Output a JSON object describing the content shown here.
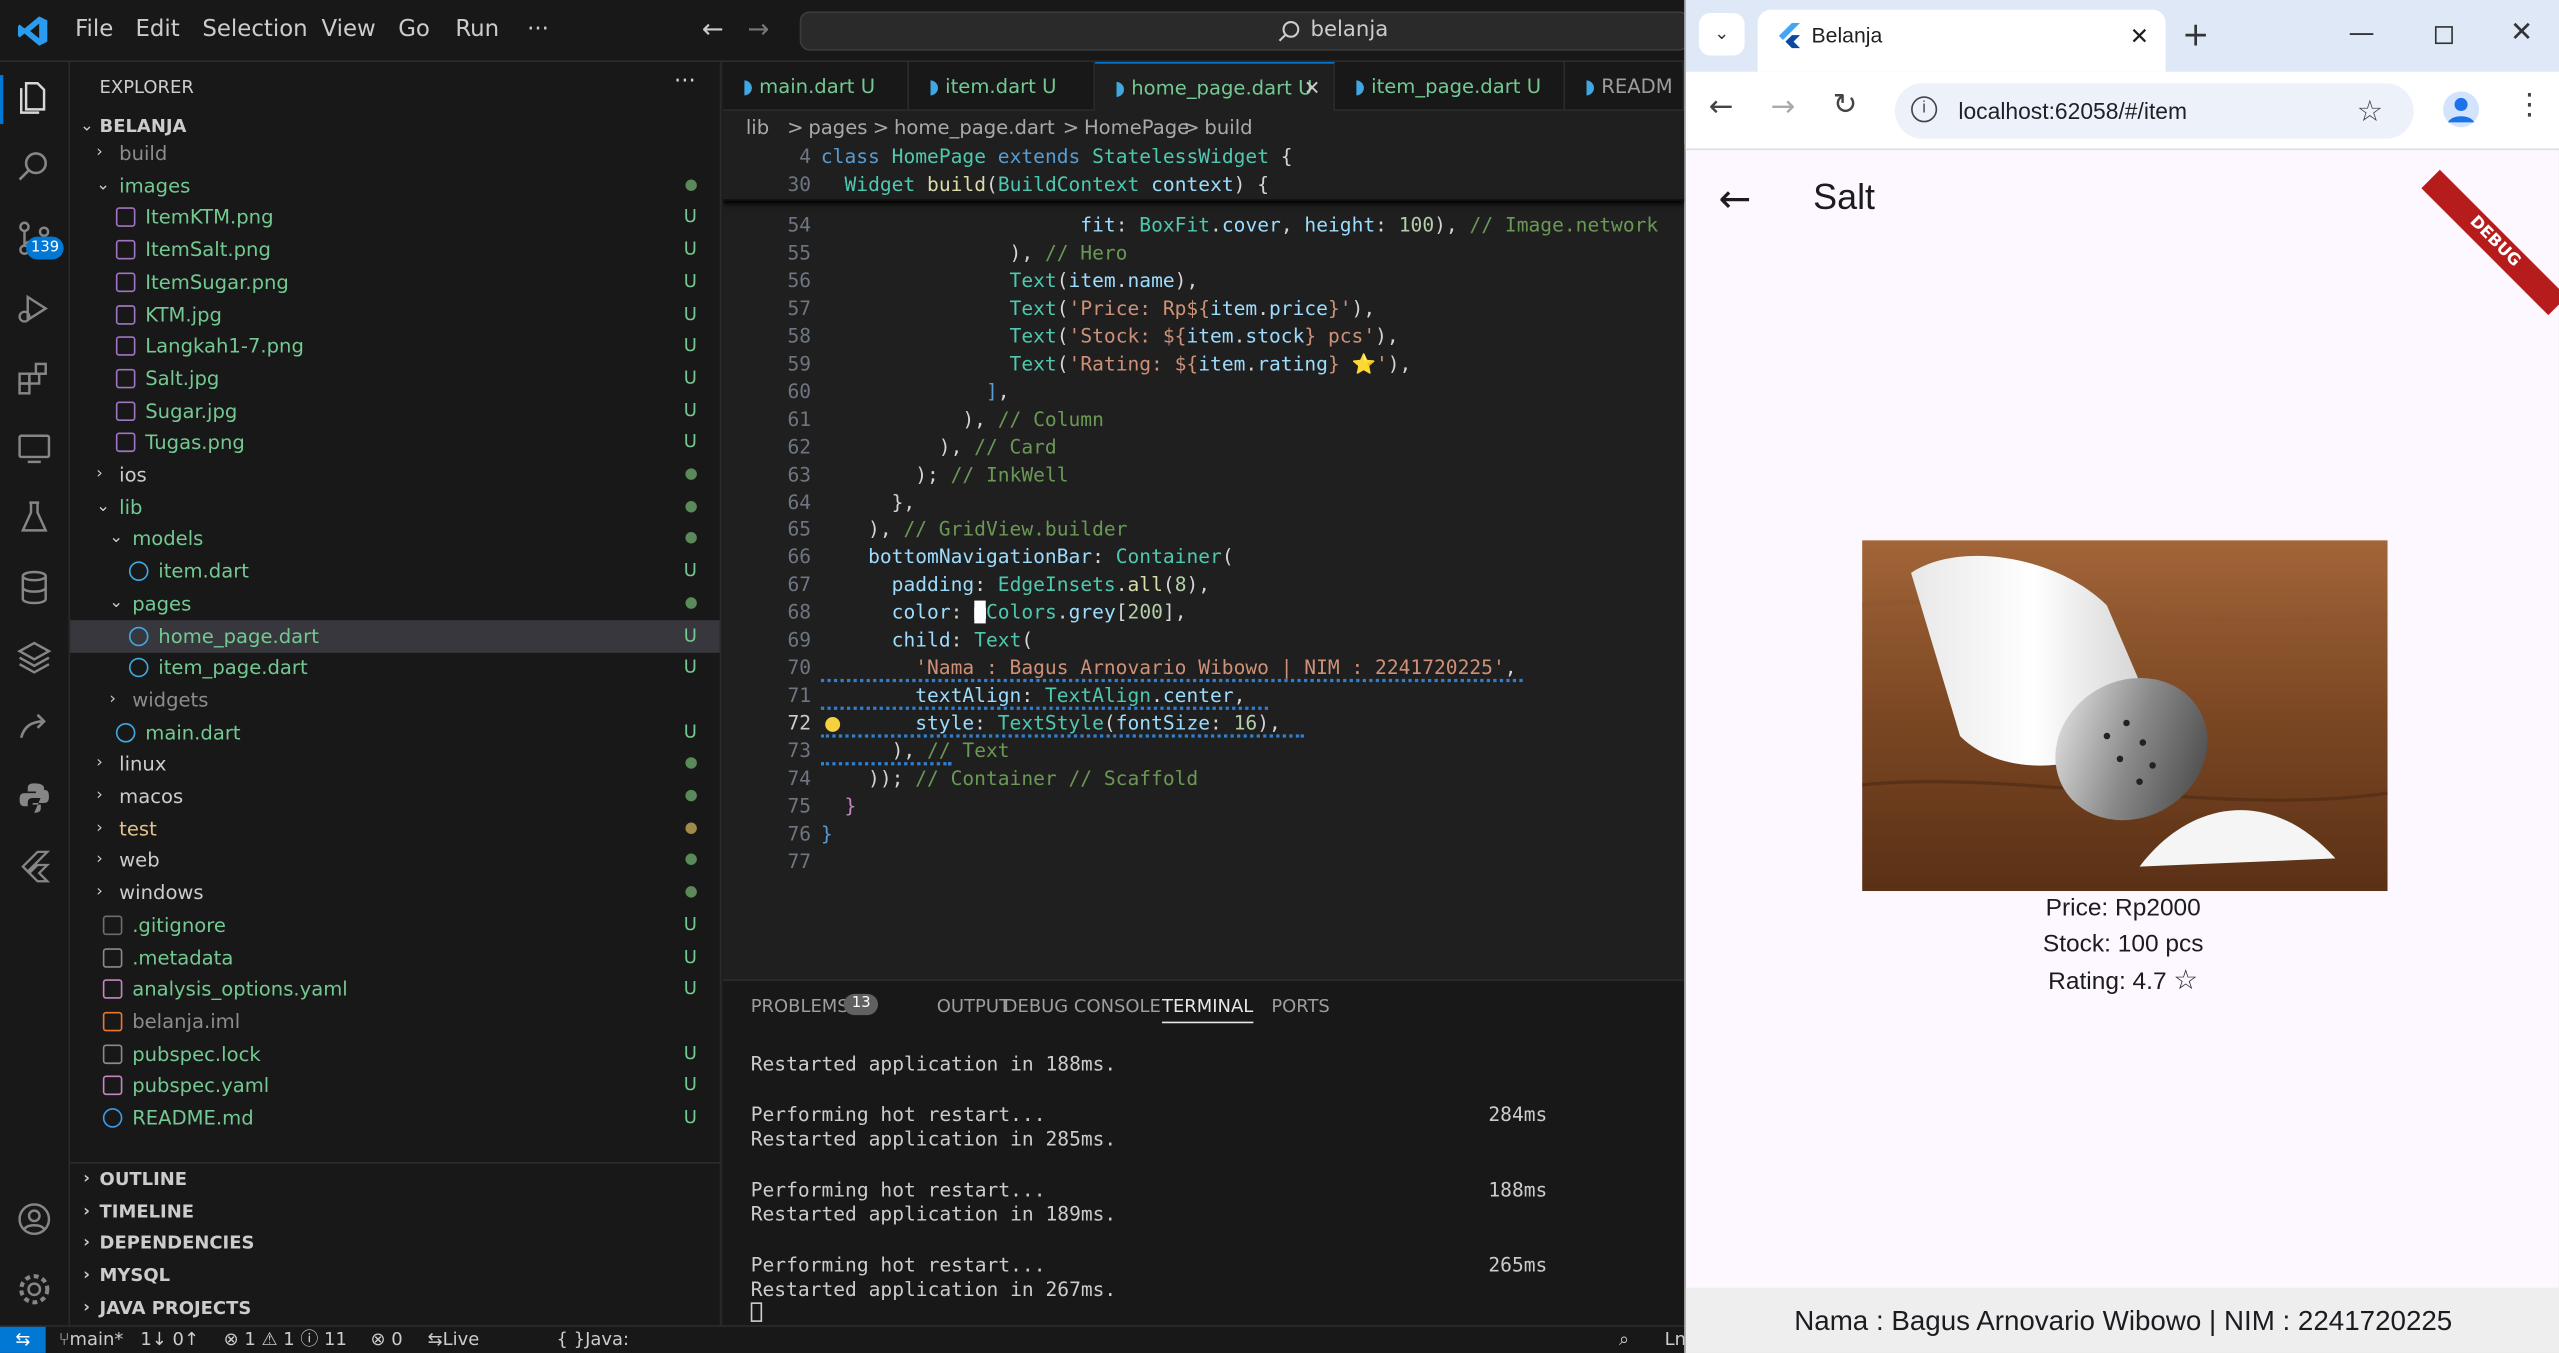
{
  "window": {
    "menu": [
      "File",
      "Edit",
      "Selection",
      "View",
      "Go",
      "Run",
      "···"
    ],
    "search_text": "belanja"
  },
  "explorer": {
    "title": "EXPLORER",
    "more": "···",
    "project": "BELANJA",
    "items": [
      {
        "label": "build",
        "type": "folder",
        "status": ""
      },
      {
        "label": "images",
        "type": "folder-open",
        "status": "dot"
      },
      {
        "label": "ItemKTM.png",
        "type": "image",
        "status": "U"
      },
      {
        "label": "ItemSalt.png",
        "type": "image",
        "status": "U"
      },
      {
        "label": "ItemSugar.png",
        "type": "image",
        "status": "U"
      },
      {
        "label": "KTM.jpg",
        "type": "image",
        "status": "U"
      },
      {
        "label": "Langkah1-7.png",
        "type": "image",
        "status": "U"
      },
      {
        "label": "Salt.jpg",
        "type": "image",
        "status": "U"
      },
      {
        "label": "Sugar.jpg",
        "type": "image",
        "status": "U"
      },
      {
        "label": "Tugas.png",
        "type": "image",
        "status": "U"
      },
      {
        "label": "ios",
        "type": "folder",
        "status": "dot"
      },
      {
        "label": "lib",
        "type": "folder-open",
        "status": "dot"
      },
      {
        "label": "models",
        "type": "folder-open",
        "status": "dot"
      },
      {
        "label": "item.dart",
        "type": "dart",
        "status": "U"
      },
      {
        "label": "pages",
        "type": "folder-open",
        "status": "dot"
      },
      {
        "label": "home_page.dart",
        "type": "dart",
        "status": "U"
      },
      {
        "label": "item_page.dart",
        "type": "dart",
        "status": "U"
      },
      {
        "label": "widgets",
        "type": "folder",
        "status": ""
      },
      {
        "label": "main.dart",
        "type": "dart",
        "status": "U"
      },
      {
        "label": "linux",
        "type": "folder",
        "status": "dot"
      },
      {
        "label": "macos",
        "type": "folder",
        "status": "dot"
      },
      {
        "label": "test",
        "type": "folder",
        "status": "dot-yellow"
      },
      {
        "label": "web",
        "type": "folder",
        "status": "dot"
      },
      {
        "label": "windows",
        "type": "folder",
        "status": "dot"
      },
      {
        "label": ".gitignore",
        "type": "git",
        "status": "U"
      },
      {
        "label": ".metadata",
        "type": "meta",
        "status": "U"
      },
      {
        "label": "analysis_options.yaml",
        "type": "yaml",
        "status": "U"
      },
      {
        "label": "belanja.iml",
        "type": "rss",
        "status": ""
      },
      {
        "label": "pubspec.lock",
        "type": "meta",
        "status": "U"
      },
      {
        "label": "pubspec.yaml",
        "type": "yaml",
        "status": "U"
      },
      {
        "label": "README.md",
        "type": "info",
        "status": "U"
      }
    ],
    "sections": [
      "OUTLINE",
      "TIMELINE",
      "DEPENDENCIES",
      "MYSQL",
      "JAVA PROJECTS"
    ]
  },
  "badges": {
    "source_control": "139"
  },
  "editor": {
    "tabs": [
      {
        "label": "main.dart",
        "status": "U"
      },
      {
        "label": "item.dart",
        "status": "U"
      },
      {
        "label": "home_page.dart",
        "status": "U"
      },
      {
        "label": "item_page.dart",
        "status": "U"
      },
      {
        "label": "READM",
        "status": ""
      }
    ],
    "breadcrumbs": [
      "lib",
      ">",
      "pages",
      ">",
      "home_page.dart",
      ">",
      "HomePage",
      ">",
      "build"
    ],
    "sticky": [
      {
        "n": "4",
        "html": "<span class='kw'>class</span> <span class='ty'>HomePage</span> <span class='kw'>extends</span> <span class='ty'>StatelessWidget</span> {"
      },
      {
        "n": "30",
        "html": "  <span class='ty'>Widget</span> <span class='fn'>build</span>(<span class='ty'>BuildContext</span> <span class='pr'>context</span>) {"
      }
    ],
    "lines": [
      {
        "n": "54",
        "html": "                      <span class='pr'>fit</span>: <span class='ty'>BoxFit</span>.<span class='pr'>cover</span>, <span class='pr'>height</span>: <span class='nu'>100</span>), <span class='cm'>// Image.network</span>"
      },
      {
        "n": "55",
        "html": "                ), <span class='cm'>// Hero</span>"
      },
      {
        "n": "56",
        "html": "                <span class='ty'>Text</span>(<span class='pr'>item</span>.<span class='pr'>name</span>),"
      },
      {
        "n": "57",
        "html": "                <span class='ty'>Text</span>(<span class='st2'>'Price: Rp${</span><span class='pr'>item</span>.<span class='pr'>price</span><span class='st2'>}'</span>),"
      },
      {
        "n": "58",
        "html": "                <span class='ty'>Text</span>(<span class='st2'>'Stock: ${</span><span class='pr'>item</span>.<span class='pr'>stock</span><span class='st2'>} pcs'</span>),"
      },
      {
        "n": "59",
        "html": "                <span class='ty'>Text</span>(<span class='st2'>'Rating: ${</span><span class='pr'>item</span>.<span class='pr'>rating</span><span class='st2'>} ⭐'</span>),"
      },
      {
        "n": "60",
        "html": "              <span class='kw'>]</span>,"
      },
      {
        "n": "61",
        "html": "            ), <span class='cm'>// Column</span>"
      },
      {
        "n": "62",
        "html": "          ), <span class='cm'>// Card</span>"
      },
      {
        "n": "63",
        "html": "        ); <span class='cm'>// InkWell</span>"
      },
      {
        "n": "64",
        "html": "      },"
      },
      {
        "n": "65",
        "html": "    ), <span class='cm'>// GridView.builder</span>"
      },
      {
        "n": "66",
        "html": "    <span class='pr'>bottomNavigationBar</span>: <span class='ty'>Container</span>("
      },
      {
        "n": "67",
        "html": "      <span class='pr'>padding</span>: <span class='ty'>EdgeInsets</span>.<span class='fn'>all</span>(<span class='nu'>8</span>),"
      },
      {
        "n": "68",
        "html": "      <span class='pr'>color</span>: <span style='background:#fff;color:#fff'>■</span><span class='ty'>Colors</span>.<span class='pr'>grey</span>[<span class='nu'>200</span>],"
      },
      {
        "n": "69",
        "html": "      <span class='pr'>child</span>: <span class='ty'>Text</span>("
      },
      {
        "n": "70",
        "html": "        <span class='st2'>'Nama : Bagus Arnovario Wibowo | NIM : 2241720225'</span>,"
      },
      {
        "n": "71",
        "html": "        <span class='pr'>textAlign</span>: <span class='ty'>TextAlign</span>.<span class='pr'>center</span>,"
      },
      {
        "n": "72",
        "html": "        <span class='pr'>style</span>: <span class='ty'>TextStyle</span>(<span class='pr'>fontSize</span>: <span class='nu'>16</span>),"
      },
      {
        "n": "73",
        "html": "      ), <span class='cm'>// Text</span>"
      },
      {
        "n": "74",
        "html": "    )); <span class='cm'>// Container // Scaffold</span>"
      },
      {
        "n": "75",
        "html": "  <span class='pu'>}</span>"
      },
      {
        "n": "76",
        "html": "<span class='kw'>}</span>"
      },
      {
        "n": "77",
        "html": ""
      }
    ]
  },
  "panel": {
    "tabs": [
      "PROBLEMS",
      "OUTPUT",
      "DEBUG CONSOLE",
      "TERMINAL",
      "PORTS"
    ],
    "problems_count": "13",
    "terminal": [
      {
        "text": "Restarted application in 188ms.",
        "time": ""
      },
      {
        "text": "",
        "time": ""
      },
      {
        "text": "Performing hot restart...",
        "time": "284ms"
      },
      {
        "text": "Restarted application in 285ms.",
        "time": ""
      },
      {
        "text": "",
        "time": ""
      },
      {
        "text": "Performing hot restart...",
        "time": "188ms"
      },
      {
        "text": "Restarted application in 189ms.",
        "time": ""
      },
      {
        "text": "",
        "time": ""
      },
      {
        "text": "Performing hot restart...",
        "time": "265ms"
      },
      {
        "text": "Restarted application in 267ms.",
        "time": ""
      }
    ]
  },
  "status": {
    "branch": "main*",
    "sync": "1↓ 0↑",
    "problems": "⊗ 1 ⚠ 1 ⓘ 11",
    "ports": "⊗ 0",
    "live_share": "Live Share",
    "java": "Java: Warning",
    "ln": "Ln"
  },
  "browser": {
    "tab_title": "Belanja",
    "url": "localhost:62058/#/item",
    "debug_banner": "DEBUG",
    "app": {
      "title": "Salt",
      "price": "Price: Rp2000",
      "stock": "Stock: 100 pcs",
      "rating": "Rating: 4.7",
      "footer": "Nama : Bagus Arnovario Wibowo | NIM : 2241720225"
    }
  },
  "colors": {
    "vscode_bg": "#1f1f1f",
    "accent": "#0078d4",
    "untracked": "#73c991",
    "flutter_bg": "#fdf7ff"
  }
}
